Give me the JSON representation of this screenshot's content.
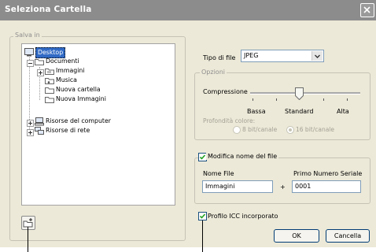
{
  "window": {
    "title": "Seleziona Cartella"
  },
  "save_in": {
    "legend": "Salva in",
    "tree": [
      {
        "label": "Desktop",
        "selected": true
      },
      {
        "label": "Documenti"
      },
      {
        "label": "Immagini"
      },
      {
        "label": "Musica"
      },
      {
        "label": "Nuova cartella"
      },
      {
        "label": "Nuova Immagini"
      },
      {
        "label": "Risorse del computer"
      },
      {
        "label": "Risorse di rete"
      }
    ]
  },
  "file_type": {
    "label": "Tipo di file",
    "value": "JPEG"
  },
  "options": {
    "legend": "Opzioni",
    "compression_label": "Compressione",
    "slider_ticks": [
      "Bassa",
      "Standard",
      "Alta"
    ],
    "slider_value": "Standard",
    "color_depth_label": "Profondità colore:",
    "radio_8bit": "8 bit/canale",
    "radio_16bit": "16 bit/canale"
  },
  "rename": {
    "checkbox_label": "Modifica nome del file",
    "checked": true,
    "name_label": "Nome File",
    "name_value": "Immagini",
    "plus": "+",
    "serial_label": "Primo Numero Seriale",
    "serial_value": "0001"
  },
  "icc": {
    "label": "Profilo ICC incorporato",
    "checked": true
  },
  "buttons": {
    "ok": "OK",
    "cancel": "Cancella"
  }
}
